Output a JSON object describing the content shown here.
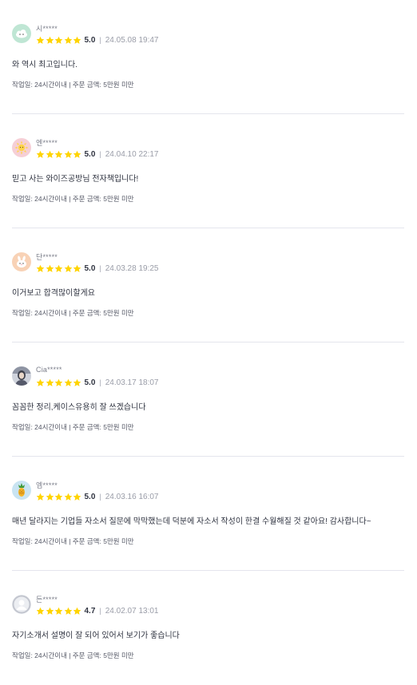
{
  "colors": {
    "star": "#ffd400",
    "text": "#303441",
    "muted": "#9a9da8",
    "divider": "#e4e5ed"
  },
  "reviews": [
    {
      "nickname": "시*****",
      "avatar_icon": "cloud-avatar-icon",
      "rating": "5.0",
      "stars": 5,
      "date": "24.05.08 19:47",
      "content": "와 역시 최고입니다.",
      "meta": "작업일: 24시간이내 | 주문 금액: 5만원 미만"
    },
    {
      "nickname": "엔*****",
      "avatar_icon": "sun-avatar-icon",
      "rating": "5.0",
      "stars": 5,
      "date": "24.04.10 22:17",
      "content": "믿고 사는 와이즈공방님 전자책입니다!",
      "meta": "작업일: 24시간이내 | 주문 금액: 5만원 미만"
    },
    {
      "nickname": "단*****",
      "avatar_icon": "bunny-avatar-icon",
      "rating": "5.0",
      "stars": 5,
      "date": "24.03.28 19:25",
      "content": "이거보고 합격많이할게요",
      "meta": "작업일: 24시간이내 | 주문 금액: 5만원 미만"
    },
    {
      "nickname": "Cia*****",
      "avatar_icon": "profile-photo-avatar-icon",
      "rating": "5.0",
      "stars": 5,
      "date": "24.03.17 18:07",
      "content": "꼼꼼한 정리,케이스유용히 잘 쓰겠습니다",
      "meta": "작업일: 24시간이내 | 주문 금액: 5만원 미만"
    },
    {
      "nickname": "엠*****",
      "avatar_icon": "pineapple-avatar-icon",
      "rating": "5.0",
      "stars": 5,
      "date": "24.03.16 16:07",
      "content": "매년 달라지는 기업들 자소서 질문에 막막했는데 덕분에 자소서 작성이 한결 수월해질 것 같아요! 감사합니다~",
      "meta": "작업일: 24시간이내 | 주문 금액: 5만원 미만"
    },
    {
      "nickname": "든*****",
      "avatar_icon": "default-avatar-icon",
      "rating": "4.7",
      "stars": 5,
      "date": "24.02.07 13:01",
      "content": "자기소개서 설명이 잘 되어 있어서 보기가 좋습니다",
      "meta": "작업일: 24시간이내 | 주문 금액: 5만원 미만"
    }
  ]
}
